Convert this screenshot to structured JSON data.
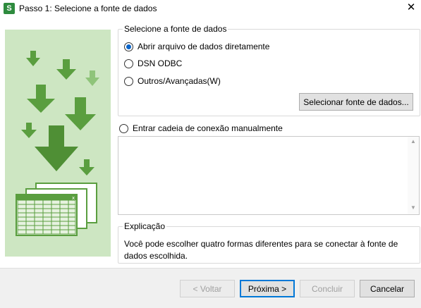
{
  "window": {
    "title": "Passo 1: Selecione a fonte de dados",
    "app_icon_letter": "S",
    "close_icon": "close-icon"
  },
  "source_group": {
    "title": "Selecione a fonte de dados",
    "options": [
      {
        "label": "Abrir arquivo de dados diretamente",
        "selected": true
      },
      {
        "label": "DSN ODBC",
        "selected": false
      },
      {
        "label": "Outros/Avançadas(W)",
        "selected": false
      }
    ],
    "select_button": "Selecionar fonte de dados..."
  },
  "manual_connection": {
    "label": "Entrar cadeia de conexão manualmente",
    "selected": false,
    "value": ""
  },
  "explanation": {
    "title": "Explicação",
    "text": "Você pode escolher quatro formas diferentes para se conectar à fonte de dados escolhida."
  },
  "footer": {
    "back": "< Voltar",
    "next": "Próxima >",
    "finish": "Concluir",
    "cancel": "Cancelar"
  },
  "colors": {
    "illustration_bg": "#cde6c2",
    "arrow_green": "#5a9e3f",
    "radio_selected": "#0a64c8",
    "app_icon": "#2e8b3e"
  }
}
